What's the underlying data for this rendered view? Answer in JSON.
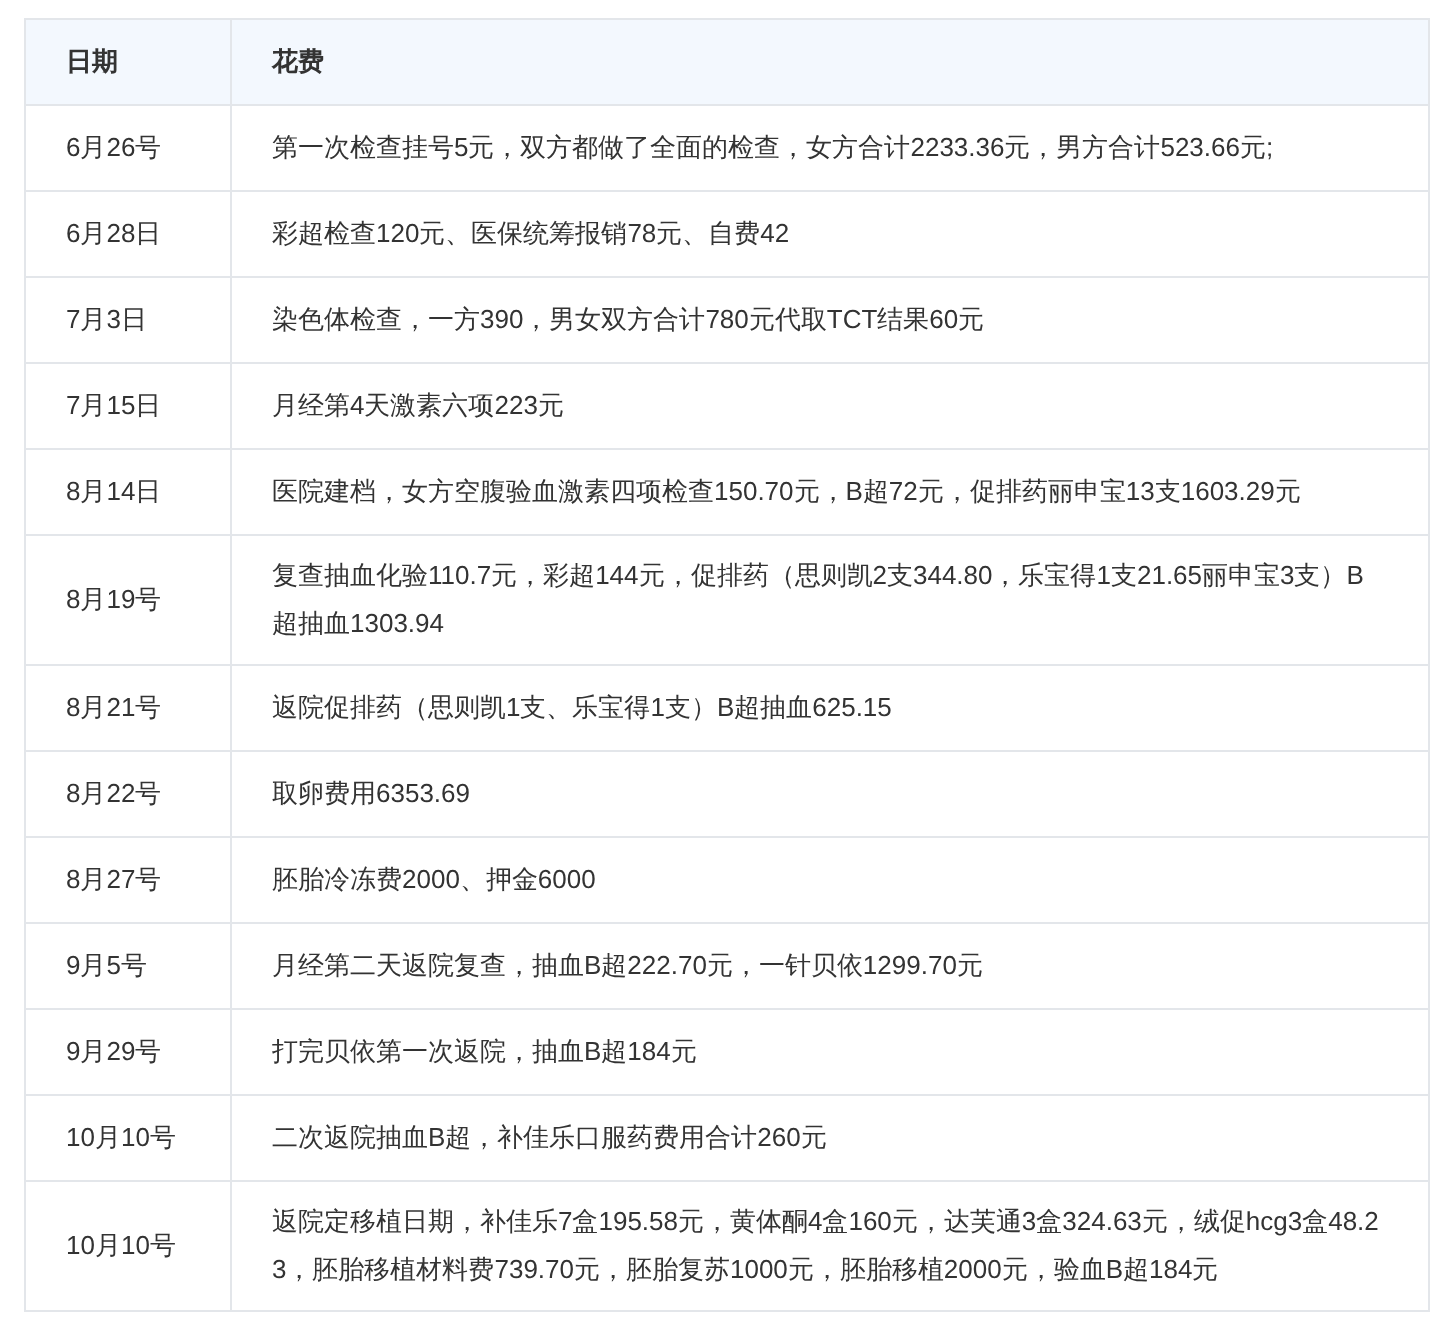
{
  "table": {
    "columns": [
      "日期",
      "花费"
    ],
    "rows": [
      [
        "6月26号",
        "第一次检查挂号5元，双方都做了全面的检查，女方合计2233.36元，男方合计523.66元;"
      ],
      [
        "6月28日",
        "彩超检查120元、医保统筹报销78元、自费42"
      ],
      [
        "7月3日",
        "染色体检查，一方390，男女双方合计780元代取TCT结果60元"
      ],
      [
        "7月15日",
        "月经第4天激素六项223元"
      ],
      [
        "8月14日",
        "医院建档，女方空腹验血激素四项检查150.70元，B超72元，促排药丽申宝13支1603.29元"
      ],
      [
        "8月19号",
        "复查抽血化验110.7元，彩超144元，促排药（思则凯2支344.80，乐宝得1支21.65丽申宝3支）B超抽血1303.94"
      ],
      [
        "8月21号",
        "返院促排药（思则凯1支、乐宝得1支）B超抽血625.15"
      ],
      [
        "8月22号",
        "取卵费用6353.69"
      ],
      [
        "8月27号",
        "胚胎冷冻费2000、押金6000"
      ],
      [
        "9月5号",
        "月经第二天返院复查，抽血B超222.70元，一针贝依1299.70元"
      ],
      [
        "9月29号",
        "打完贝依第一次返院，抽血B超184元"
      ],
      [
        "10月10号",
        "二次返院抽血B超，补佳乐口服药费用合计260元"
      ],
      [
        "10月10号",
        "返院定移植日期，补佳乐7盒195.58元，黄体酮4盒160元，达芙通3盒324.63元，绒促hcg3盒48.23，胚胎移植材料费739.70元，胚胎复苏1000元，胚胎移植2000元，验血B超184元"
      ]
    ]
  }
}
